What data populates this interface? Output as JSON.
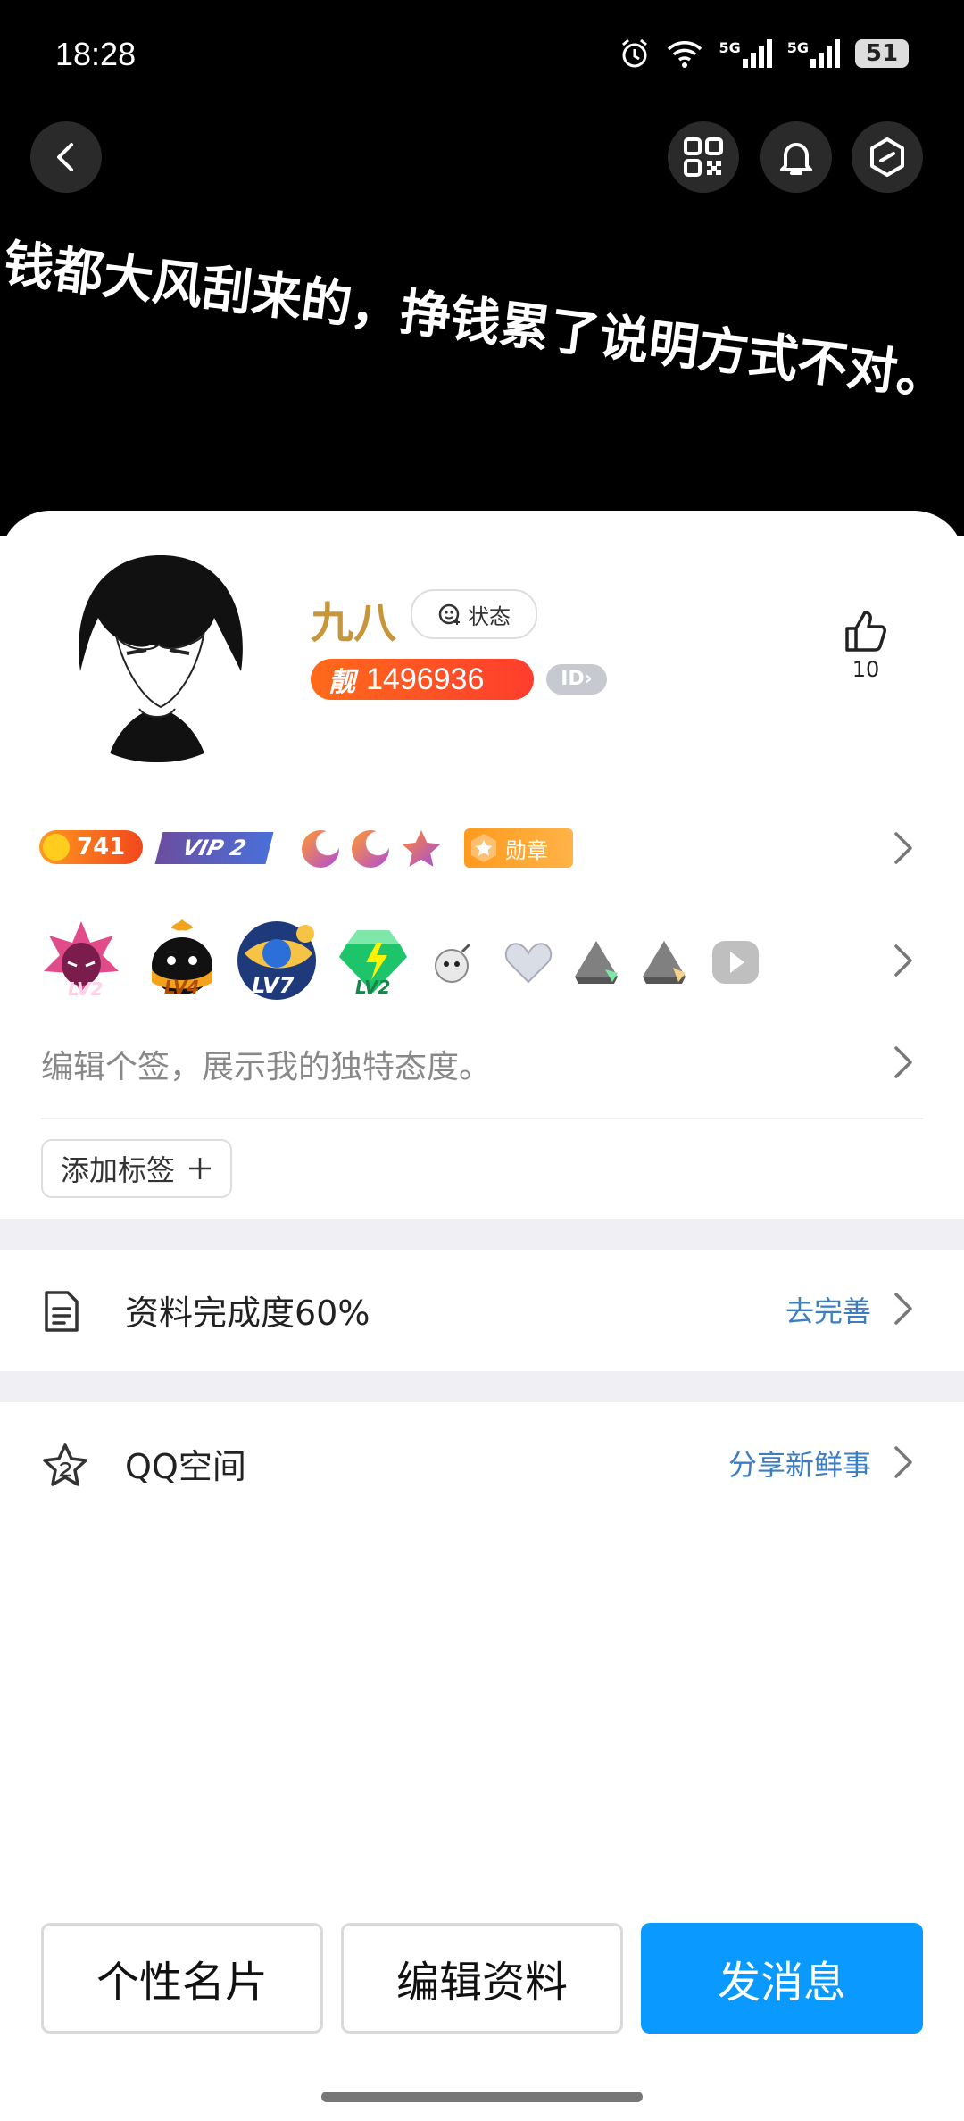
{
  "status_bar": {
    "time": "18:28",
    "network_1": "5G",
    "network_2": "5G",
    "battery": "51"
  },
  "header": {
    "motto": "钱都大风刮来的，挣钱累了说明方式不对。"
  },
  "profile": {
    "name": "九八",
    "status_label": "状态",
    "liang_label": "靓",
    "qq_number": "1496936",
    "id_label": "ID",
    "likes": "10",
    "coin_value": "741",
    "vip_label": "VIP 2",
    "medal_label": "勋章",
    "level_labels": [
      "LV2",
      "LV4",
      "LV7",
      "LV2"
    ],
    "signature_placeholder": "编辑个签，展示我的独特态度。",
    "add_tag_label": "添加标签"
  },
  "list": [
    {
      "label": "资料完成度60%",
      "action": "去完善"
    },
    {
      "label": "QQ空间",
      "action": "分享新鲜事"
    }
  ],
  "buttons": {
    "card": "个性名片",
    "edit": "编辑资料",
    "message": "发消息"
  },
  "colors": {
    "accent": "#0a99ff",
    "name_gold": "#c8963a",
    "link_blue": "#3d7ec2"
  }
}
